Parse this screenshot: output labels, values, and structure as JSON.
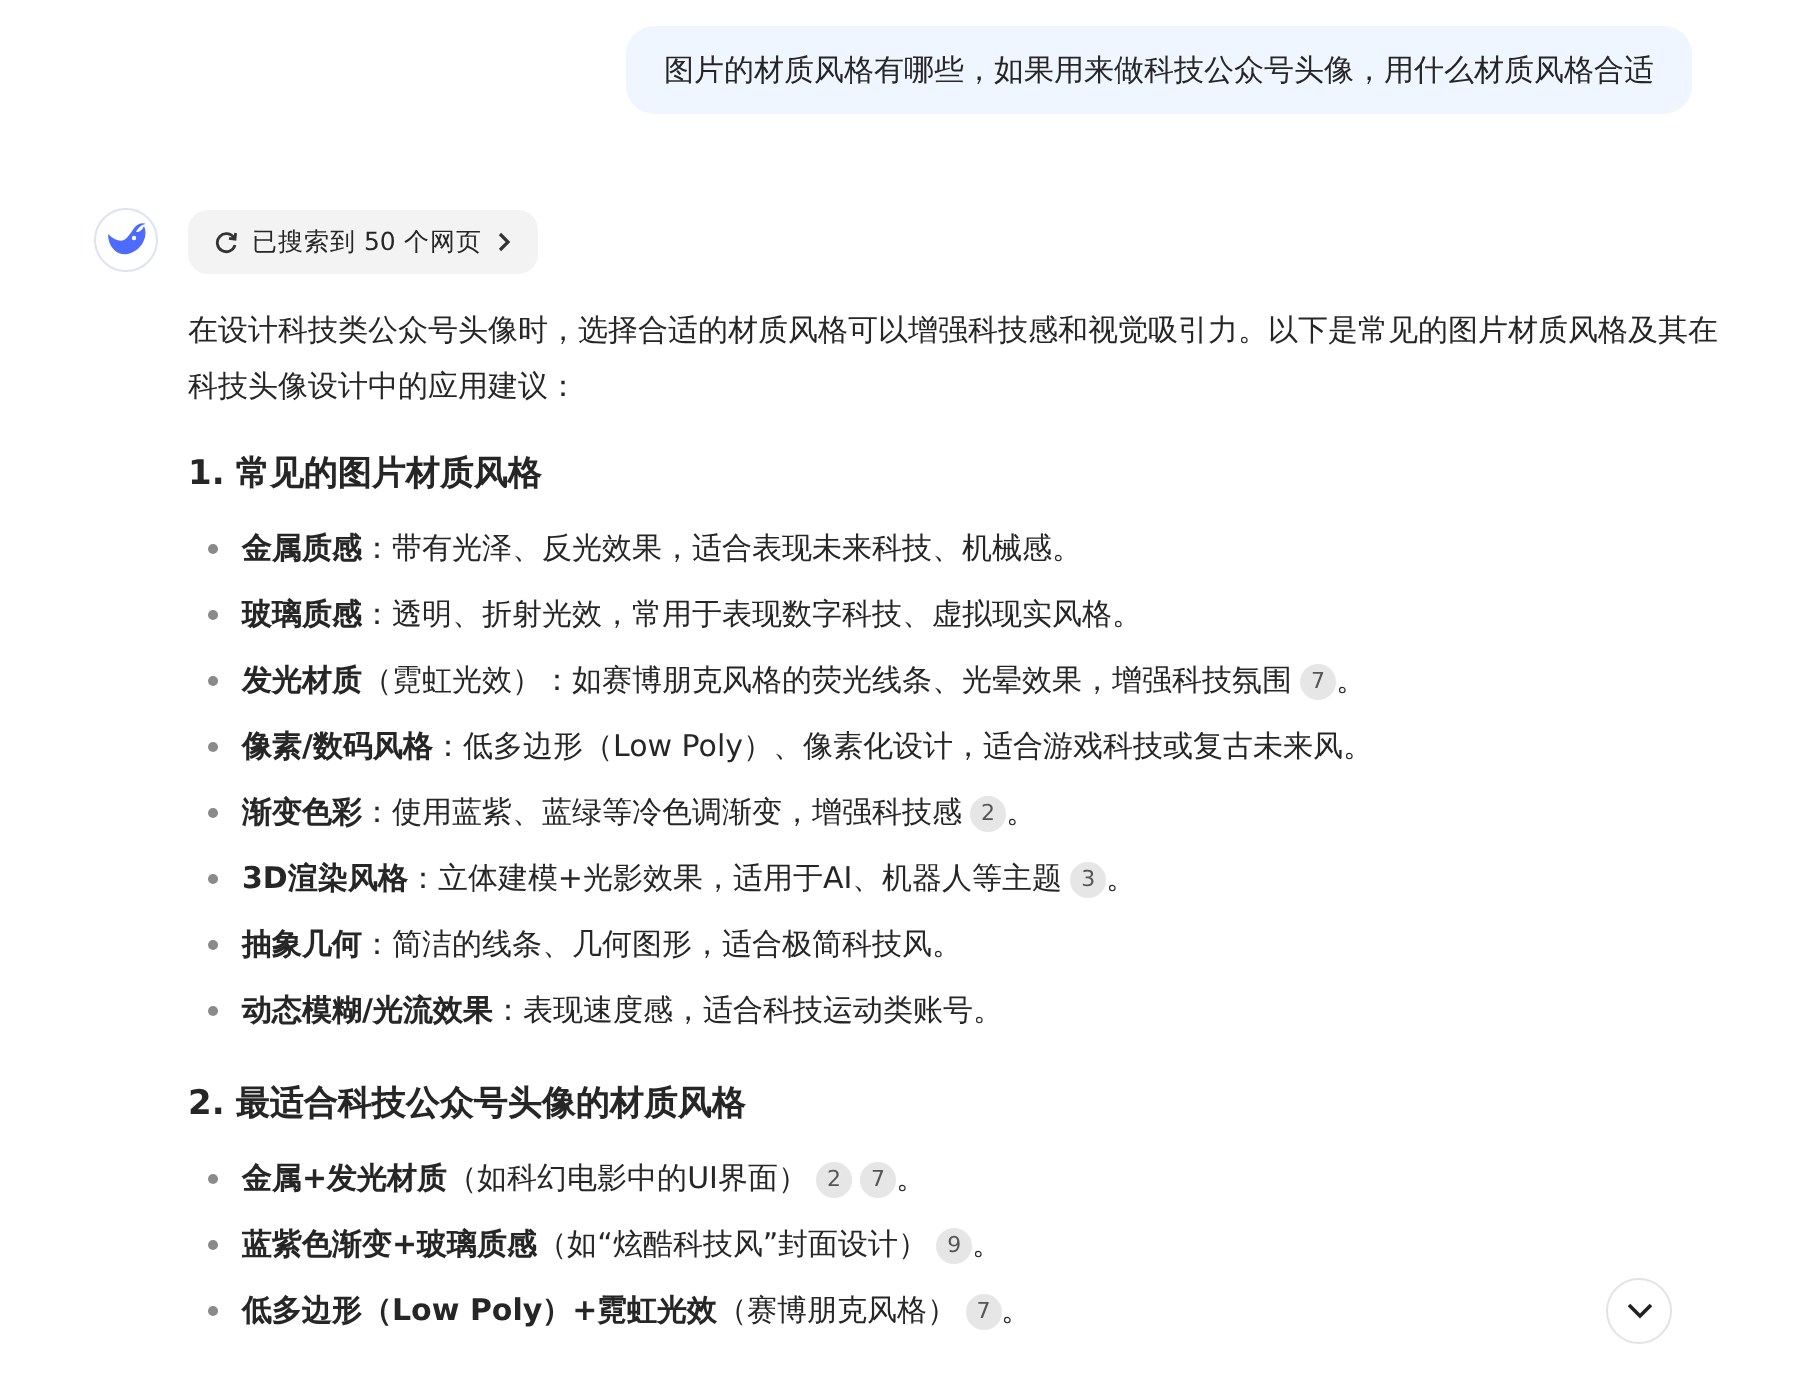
{
  "user_message": "图片的材质风格有哪些，如果用来做科技公众号头像，用什么材质风格合适",
  "search_chip": {
    "label": "已搜索到 50 个网页"
  },
  "intro": "在设计科技类公众号头像时，选择合适的材质风格可以增强科技感和视觉吸引力。以下是常见的图片材质风格及其在科技头像设计中的应用建议：",
  "sections": [
    {
      "heading": "1. 常见的图片材质风格",
      "items": [
        {
          "text": "**金属质感**：带有光泽、反光效果，适合表现未来科技、机械感。"
        },
        {
          "text": "**玻璃质感**：透明、折射光效，常用于表现数字科技、虚拟现实风格。"
        },
        {
          "text": "**发光材质**（霓虹光效）：如赛博朋克风格的荧光线条、光晕效果，增强科技氛围",
          "citations": [
            "7"
          ],
          "end": "。"
        },
        {
          "text": "**像素/数码风格**：低多边形（Low Poly）、像素化设计，适合游戏科技或复古未来风。"
        },
        {
          "text": "**渐变色彩**：使用蓝紫、蓝绿等冷色调渐变，增强科技感",
          "citations": [
            "2"
          ],
          "end": "。"
        },
        {
          "text": "**3D渲染风格**：立体建模+光影效果，适用于AI、机器人等主题",
          "citations": [
            "3"
          ],
          "end": "。"
        },
        {
          "text": "**抽象几何**：简洁的线条、几何图形，适合极简科技风。"
        },
        {
          "text": "**动态模糊/光流效果**：表现速度感，适合科技运动类账号。"
        }
      ]
    },
    {
      "heading": "2. 最适合科技公众号头像的材质风格",
      "items": [
        {
          "text": "**金属+发光材质**（如科幻电影中的UI界面）",
          "citations": [
            "2",
            "7"
          ],
          "end": "。"
        },
        {
          "text": "**蓝紫色渐变+玻璃质感**（如“炫酷科技风”封面设计）",
          "citations": [
            "9"
          ],
          "end": "。"
        },
        {
          "text": "**低多边形（Low Poly）+霓虹光效**（赛博朋克风格）",
          "citations": [
            "7"
          ],
          "end": "。"
        }
      ]
    }
  ]
}
